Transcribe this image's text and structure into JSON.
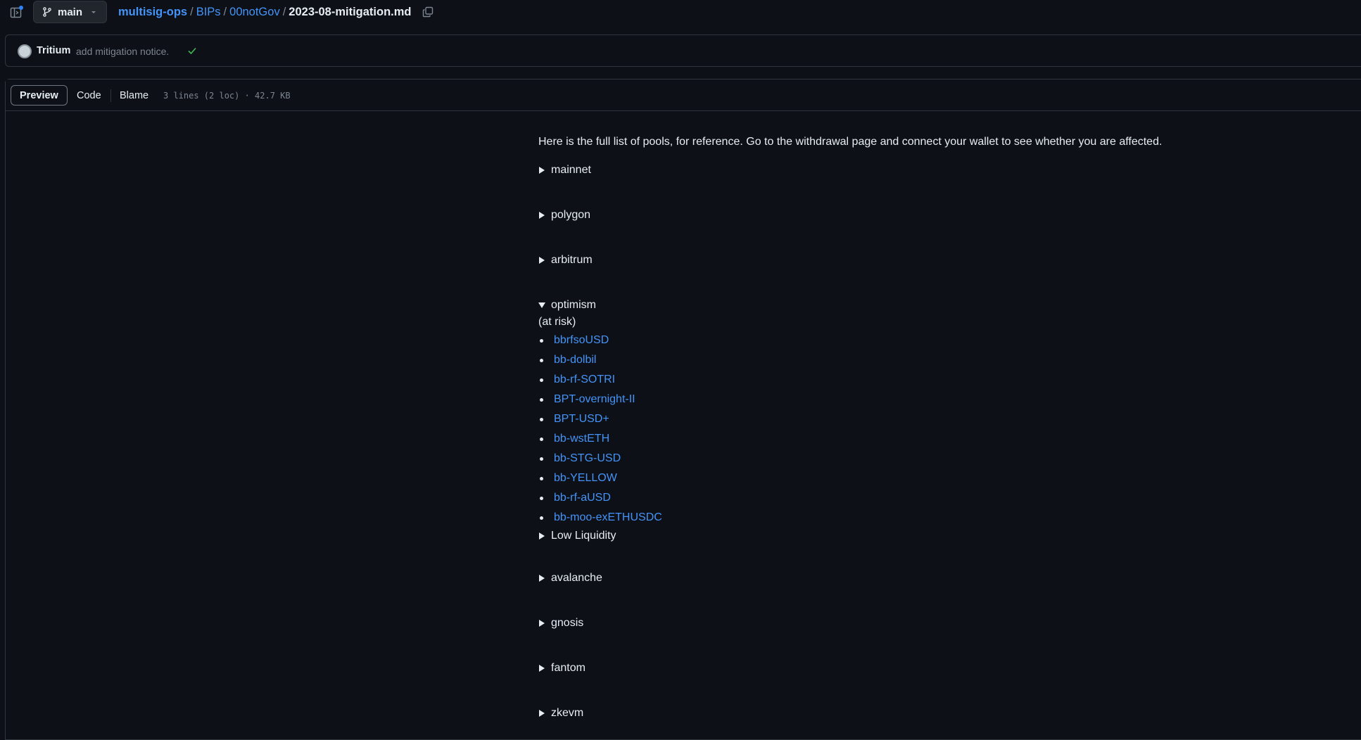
{
  "header": {
    "branch": "main",
    "breadcrumb": {
      "repo": "multisig-ops",
      "dir1": "BIPs",
      "dir2": "00notGov",
      "file": "2023-08-mitigation.md",
      "separator": "/"
    }
  },
  "commit": {
    "author": "Tritium",
    "message": "add mitigation notice.",
    "status": "success"
  },
  "file_header": {
    "tabs": [
      "Preview",
      "Code",
      "Blame"
    ],
    "active_tab": "Preview",
    "meta": "3 lines (2 loc) · 42.7 KB"
  },
  "content": {
    "intro": "Here is the full list of pools, for reference. Go to the withdrawal page and connect your wallet to see whether you are affected.",
    "sections": {
      "mainnet": "mainnet",
      "polygon": "polygon",
      "arbitrum": "arbitrum",
      "optimism": "optimism",
      "low_liquidity": "Low Liquidity",
      "avalanche": "avalanche",
      "gnosis": "gnosis",
      "fantom": "fantom",
      "zkevm": "zkevm"
    },
    "optimism_note": "(at risk)",
    "optimism_pools": [
      "bbrfsoUSD",
      "bb-dolbil",
      "bb-rf-SOTRI",
      "BPT-overnight-II",
      "BPT-USD+",
      "bb-wstETH",
      "bb-STG-USD",
      "bb-YELLOW",
      "bb-rf-aUSD",
      "bb-moo-exETHUSDC"
    ]
  },
  "colors": {
    "background": "#0d1117",
    "text": "#e6edf3",
    "link": "#4493f8",
    "muted": "#7d8590",
    "border": "#30363d",
    "success": "#3fb950"
  }
}
